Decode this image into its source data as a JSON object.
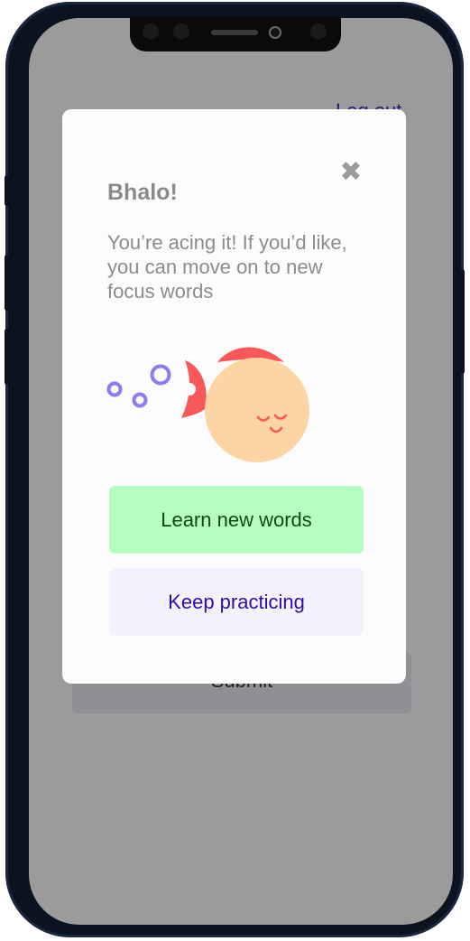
{
  "background_page": {
    "logout_label": "Log out",
    "submit_label": "Submit"
  },
  "modal": {
    "title": "Bhalo!",
    "message": "You’re acing it! If you’d like, you can move on to new focus words",
    "close_symbol": "✖",
    "primary_button_label": "Learn new words",
    "secondary_button_label": "Keep practicing"
  },
  "colors": {
    "overlay": "#9b9b9b",
    "modal_bg": "#fdfcfc",
    "primary_bg": "#b6fdc0",
    "primary_text": "#0d4a17",
    "secondary_bg": "#f5f2fe",
    "secondary_text": "#2c0fa0",
    "fish_body": "#fdd5a4",
    "fish_fin": "#f9585a",
    "bubbles": "#8a7cf3"
  },
  "icons": [
    "close-icon",
    "fish-illustration",
    "bubble-icon"
  ]
}
